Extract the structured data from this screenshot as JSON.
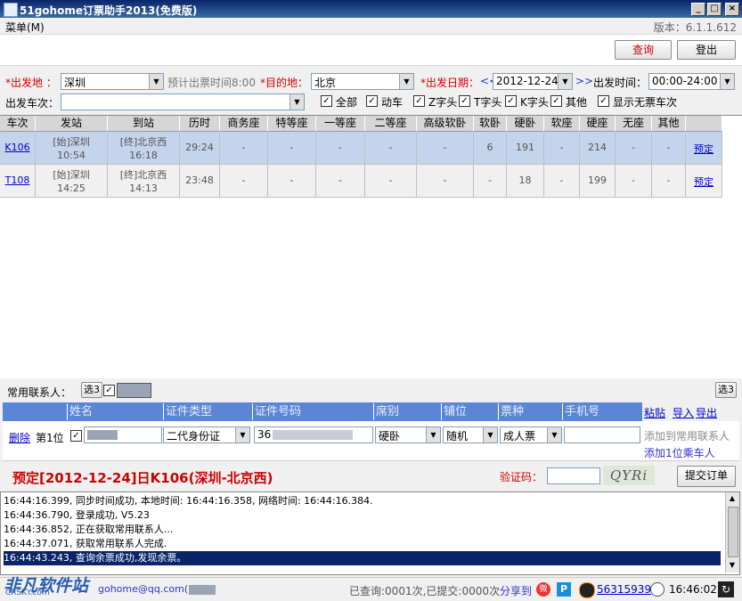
{
  "window": {
    "title": "51gohome订票助手2013(免费版)",
    "min": "_",
    "max": "□",
    "close": "×"
  },
  "menu": {
    "label": "菜单(M)",
    "version": "版本：6.1.1.612"
  },
  "toolbar": {
    "query": "查询",
    "logout": "登出"
  },
  "form": {
    "from_label": "*出发地 ：",
    "from_value": "深圳",
    "hint": "预计出票时间8:00",
    "to_label": "*目的地：",
    "to_value": "北京",
    "date_label": "*出发日期：",
    "prev": "<<",
    "date_value": "2012-12-24",
    "next": ">>",
    "time_label": "出发时间：",
    "time_value": "00:00-24:00",
    "train_label": "出发车次：",
    "train_value": "",
    "filters": [
      {
        "label": "全部",
        "checked": true
      },
      {
        "label": "动车",
        "checked": true
      },
      {
        "label": "Z字头",
        "checked": true
      },
      {
        "label": "T字头",
        "checked": true
      },
      {
        "label": "K字头",
        "checked": true
      },
      {
        "label": "其他",
        "checked": true
      },
      {
        "label": "显示无票车次",
        "checked": true
      }
    ]
  },
  "grid": {
    "headers": [
      "车次",
      "发站",
      "到站",
      "历时",
      "商务座",
      "特等座",
      "一等座",
      "二等座",
      "高级软卧",
      "软卧",
      "硬卧",
      "软座",
      "硬座",
      "无座",
      "其他"
    ],
    "rows": [
      {
        "train": "K106",
        "from": "[始]深圳",
        "dep": "10:54",
        "to": "[终]北京西",
        "arr": "16:18",
        "duration": "29:24",
        "cells": [
          "-",
          "-",
          "-",
          "-",
          "-",
          "6",
          "191",
          "-",
          "214",
          "-",
          "-"
        ],
        "action": "预定"
      },
      {
        "train": "T108",
        "from": "[始]深圳",
        "dep": "14:25",
        "to": "[终]北京西",
        "arr": "14:13",
        "duration": "23:48",
        "cells": [
          "-",
          "-",
          "-",
          "-",
          "-",
          "-",
          "18",
          "-",
          "199",
          "-",
          "-"
        ],
        "action": "预定"
      }
    ]
  },
  "contacts": {
    "label": "常用联系人：",
    "select_btn": "选3",
    "select_btn_right": "选3"
  },
  "passenger": {
    "headers": [
      "姓名",
      "证件类型",
      "证件号码",
      "席别",
      "铺位",
      "票种",
      "手机号"
    ],
    "actions": [
      "粘贴",
      "导入",
      "导出"
    ],
    "row": {
      "delete": "删除",
      "seat_no": "第1位",
      "id_type": "二代身份证",
      "id_number": "36",
      "seat": "硬卧",
      "berth": "随机",
      "ticket": "成人票",
      "phone": ""
    },
    "add_contact": "添加到常用联系人",
    "add_passenger": "添加1位乘车人"
  },
  "booking": {
    "title": "预定[2012-12-24]日K106(深圳-北京西)",
    "captcha_label": "验证码：",
    "captcha_text": "QYRi",
    "submit": "提交订单"
  },
  "log": [
    "16:44:16.399, 同步时间成功, 本地时间: 16:44:16.358, 网络时间: 16:44:16.384.",
    "16:44:36.790, 登录成功, V5.23",
    "16:44:36.852, 正在获取常用联系人...",
    "16:44:37.071, 获取常用联系人完成.",
    "16:44:43.243, 查询余票成功,发现余票。"
  ],
  "status": {
    "account": "gohome@qq.com(",
    "counts": "已查询:0001次,已提交:0000次",
    "share": "分享到",
    "qq": "56315939",
    "time": "16:46:02",
    "watermark": "非凡软件站",
    "watermark_sub": "CRSKY.com"
  }
}
